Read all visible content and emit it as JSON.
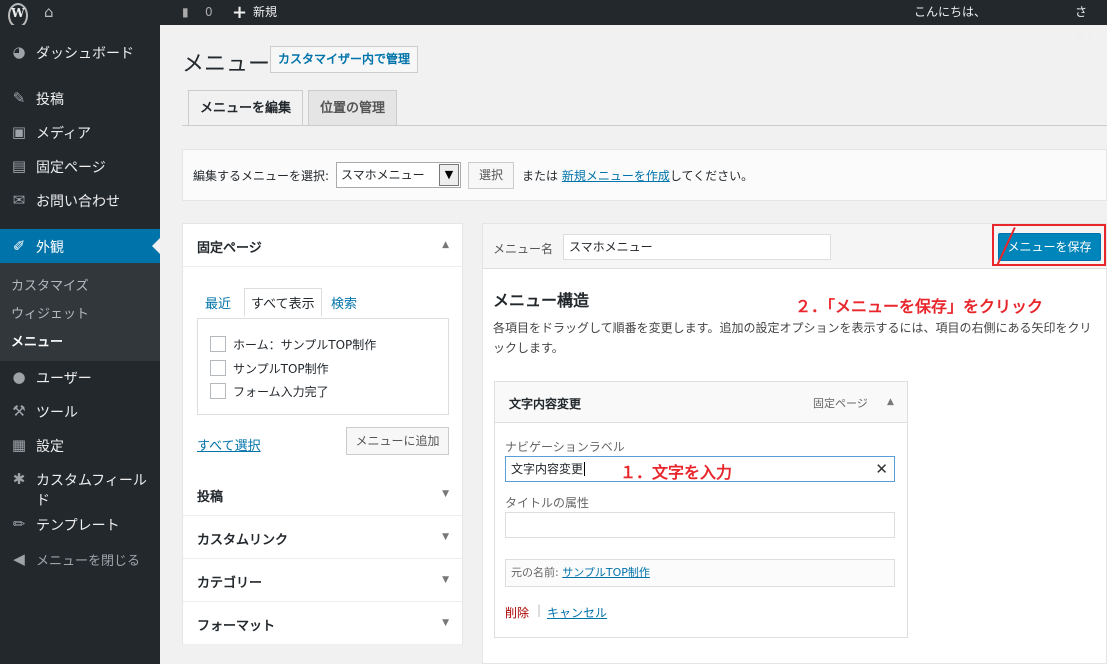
{
  "adminbar": {
    "logo": "W",
    "comment_count": "0",
    "new_label": "新規",
    "greeting": "こんにちは、",
    "greeting_end": "さん！"
  },
  "sidebar": {
    "items": [
      {
        "label": "ダッシュボード",
        "icon": "dashboard-icon"
      },
      {
        "label": "投稿",
        "icon": "pin-icon"
      },
      {
        "label": "メディア",
        "icon": "media-icon"
      },
      {
        "label": "固定ページ",
        "icon": "page-icon"
      },
      {
        "label": "お問い合わせ",
        "icon": "mail-icon"
      },
      {
        "label": "外観",
        "icon": "brush-icon"
      },
      {
        "label": "ユーザー",
        "icon": "user-icon"
      },
      {
        "label": "ツール",
        "icon": "wrench-icon"
      },
      {
        "label": "設定",
        "icon": "settings-icon"
      },
      {
        "label": "カスタムフィールド",
        "icon": "gear-icon"
      },
      {
        "label": "テンプレート",
        "icon": "pen-icon"
      }
    ],
    "submenu": [
      "カスタマイズ",
      "ウィジェット",
      "メニュー"
    ],
    "collapse_label": "メニューを閉じる",
    "active_color": "#0073aa"
  },
  "header": {
    "title": "メニュー",
    "customizer_button": "カスタマイザー内で管理"
  },
  "tabs": [
    "メニューを編集",
    "位置の管理"
  ],
  "select_bar": {
    "label": "編集するメニューを選択:",
    "selected": "スマホメニュー",
    "button": "選択",
    "or_text": "または",
    "create_link": "新規メニューを作成",
    "suffix": "してください。"
  },
  "side_panel": {
    "title": "固定ページ",
    "tabs": [
      "最近",
      "すべて表示",
      "検索"
    ],
    "pages": [
      "ホーム：サンプルTOP制作",
      "サンプルTOP制作",
      "フォーム入力完了"
    ],
    "select_all": "すべて選択",
    "add_button": "メニューに追加",
    "sections": [
      "投稿",
      "カスタムリンク",
      "カテゴリー",
      "フォーマット"
    ]
  },
  "manage": {
    "name_label": "メニュー名",
    "name_value": "スマホメニュー",
    "save_button": "メニューを保存",
    "structure_title": "メニュー構造",
    "structure_desc": "各項目をドラッグして順番を変更します。追加の設定オプションを表示するには、項目の右側にある矢印をクリックします。",
    "item": {
      "title": "文字内容変更",
      "type": "固定ページ",
      "nav_label": "ナビゲーションラベル",
      "nav_value": "文字内容変更",
      "title_attr_label": "タイトルの属性",
      "title_attr_value": "",
      "original_label": "元の名前:",
      "original_link": "サンプルTOP制作",
      "delete": "削除",
      "separator": "|",
      "cancel": "キャンセル"
    }
  },
  "annotations": {
    "step1": "１．文字を入力",
    "step2": "２．「メニューを保存」をクリック",
    "color": "#e8262c"
  }
}
